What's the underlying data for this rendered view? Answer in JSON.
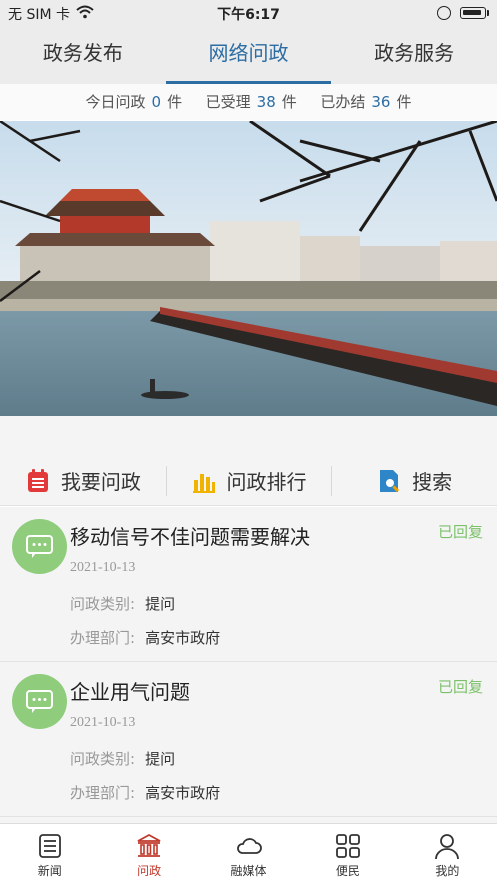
{
  "status_bar": {
    "carrier": "无 SIM 卡",
    "time": "下午6:17"
  },
  "top_tabs": [
    {
      "label": "政务发布",
      "active": false
    },
    {
      "label": "网络问政",
      "active": true
    },
    {
      "label": "政务服务",
      "active": false
    }
  ],
  "stats": {
    "today_label": "今日问政",
    "today_value": "0",
    "accepted_label": "已受理",
    "accepted_value": "38",
    "done_label": "已办结",
    "done_value": "36",
    "unit": "件"
  },
  "actions": [
    {
      "label": "我要问政",
      "icon": "calendar-icon",
      "color": "#e23a3a"
    },
    {
      "label": "问政排行",
      "icon": "bar-chart-icon",
      "color": "#f0b400"
    },
    {
      "label": "搜索",
      "icon": "search-doc-icon",
      "color": "#2e86c9"
    }
  ],
  "list": [
    {
      "title": "移动信号不佳问题需要解决",
      "status": "已回复",
      "date": "2021-10-13",
      "type_label": "问政类别:",
      "type_value": "提问",
      "dept_label": "办理部门:",
      "dept_value": "高安市政府"
    },
    {
      "title": "企业用气问题",
      "status": "已回复",
      "date": "2021-10-13",
      "type_label": "问政类别:",
      "type_value": "提问",
      "dept_label": "办理部门:",
      "dept_value": "高安市政府"
    }
  ],
  "bottom_nav": [
    {
      "label": "新闻",
      "icon": "news-icon",
      "active": false
    },
    {
      "label": "问政",
      "icon": "government-building-icon",
      "active": true
    },
    {
      "label": "融媒体",
      "icon": "cloud-icon",
      "active": false
    },
    {
      "label": "便民",
      "icon": "grid-icon",
      "active": false
    },
    {
      "label": "我的",
      "icon": "user-icon",
      "active": false
    }
  ],
  "colors": {
    "accent": "#2c6da3",
    "replied": "#7cc16a",
    "avatar": "#8fcc7c",
    "nav_active": "#c0392b"
  }
}
